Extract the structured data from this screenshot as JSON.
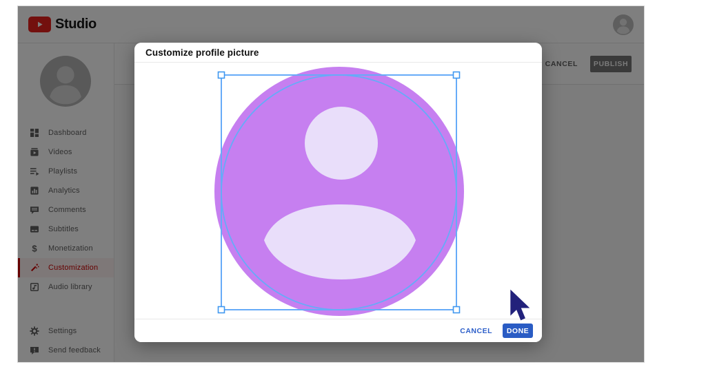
{
  "topbar": {
    "brand_text": "Studio",
    "page_actions": {
      "cancel_label": "CANCEL",
      "publish_label": "PUBLISH"
    }
  },
  "sidebar": {
    "items": [
      {
        "label": "Dashboard",
        "icon": "dashboard-icon",
        "active": false
      },
      {
        "label": "Videos",
        "icon": "videos-icon",
        "active": false
      },
      {
        "label": "Playlists",
        "icon": "playlists-icon",
        "active": false
      },
      {
        "label": "Analytics",
        "icon": "analytics-icon",
        "active": false
      },
      {
        "label": "Comments",
        "icon": "comments-icon",
        "active": false
      },
      {
        "label": "Subtitles",
        "icon": "subtitles-icon",
        "active": false
      },
      {
        "label": "Monetization",
        "icon": "monetization-icon",
        "active": false
      },
      {
        "label": "Customization",
        "icon": "customization-icon",
        "active": true
      },
      {
        "label": "Audio library",
        "icon": "audio-library-icon",
        "active": false
      }
    ],
    "footer_items": [
      {
        "label": "Settings",
        "icon": "settings-icon"
      },
      {
        "label": "Send feedback",
        "icon": "feedback-icon"
      }
    ]
  },
  "modal": {
    "title": "Customize profile picture",
    "cancel_label": "CANCEL",
    "done_label": "DONE"
  },
  "colors": {
    "logo_red": "#e6211c",
    "active_red": "#cc0000",
    "action_blue": "#2a5cc4",
    "crop_outline_blue": "#66abf8",
    "avatar_purple": "#c67ff0",
    "avatar_silhouette": "#e9defa",
    "cursor_navy": "#22217b",
    "scrim": "rgba(0,0,0,0.5)"
  }
}
